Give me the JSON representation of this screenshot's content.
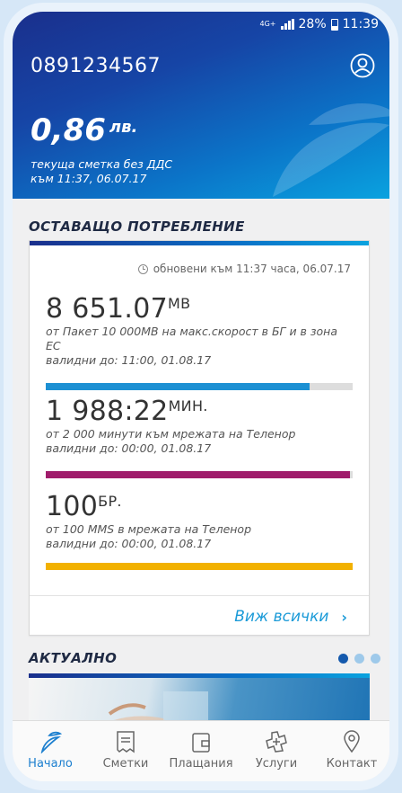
{
  "status_bar": {
    "network": "4G+",
    "battery": "28%",
    "time": "11:39"
  },
  "header": {
    "phone_number": "0891234567",
    "balance_amount": "0,86",
    "balance_currency": "лв.",
    "balance_label": "текуща сметка без ДДС",
    "balance_time": "към 11:37, 06.07.17"
  },
  "remaining": {
    "title": "ОСТАВАЩО ПОТРЕБЛЕНИЕ",
    "updated": "обновени към 11:37 часа, 06.07.17",
    "items": [
      {
        "value": "8 651.07",
        "unit": "MB",
        "description": "от Пакет 10 000MB на макс.скорост в БГ и в зона ЕС",
        "valid": "валидни до: 11:00, 01.08.17",
        "progress": 0.86,
        "color": "#1c90d3"
      },
      {
        "value": "1 988:22",
        "unit": "МИН.",
        "description": "от 2 000 минути към мрежата на Теленор",
        "valid": "валидни до: 00:00, 01.08.17",
        "progress": 0.99,
        "color": "#a01c6b"
      },
      {
        "value": "100",
        "unit": "БР.",
        "description": "от 100 MMS в мрежата на Теленор",
        "valid": "валидни до: 00:00, 01.08.17",
        "progress": 1.0,
        "color": "#f2b100"
      }
    ],
    "see_all": "Виж всички"
  },
  "news": {
    "title": "АКТУАЛНО",
    "pages": 3,
    "active_page": 0
  },
  "nav": {
    "items": [
      {
        "label": "Начало",
        "icon": "telenor-logo-icon",
        "active": true
      },
      {
        "label": "Сметки",
        "icon": "bill-icon",
        "active": false
      },
      {
        "label": "Плащания",
        "icon": "wallet-icon",
        "active": false
      },
      {
        "label": "Услуги",
        "icon": "services-icon",
        "active": false
      },
      {
        "label": "Контакт",
        "icon": "location-pin-icon",
        "active": false
      }
    ]
  }
}
